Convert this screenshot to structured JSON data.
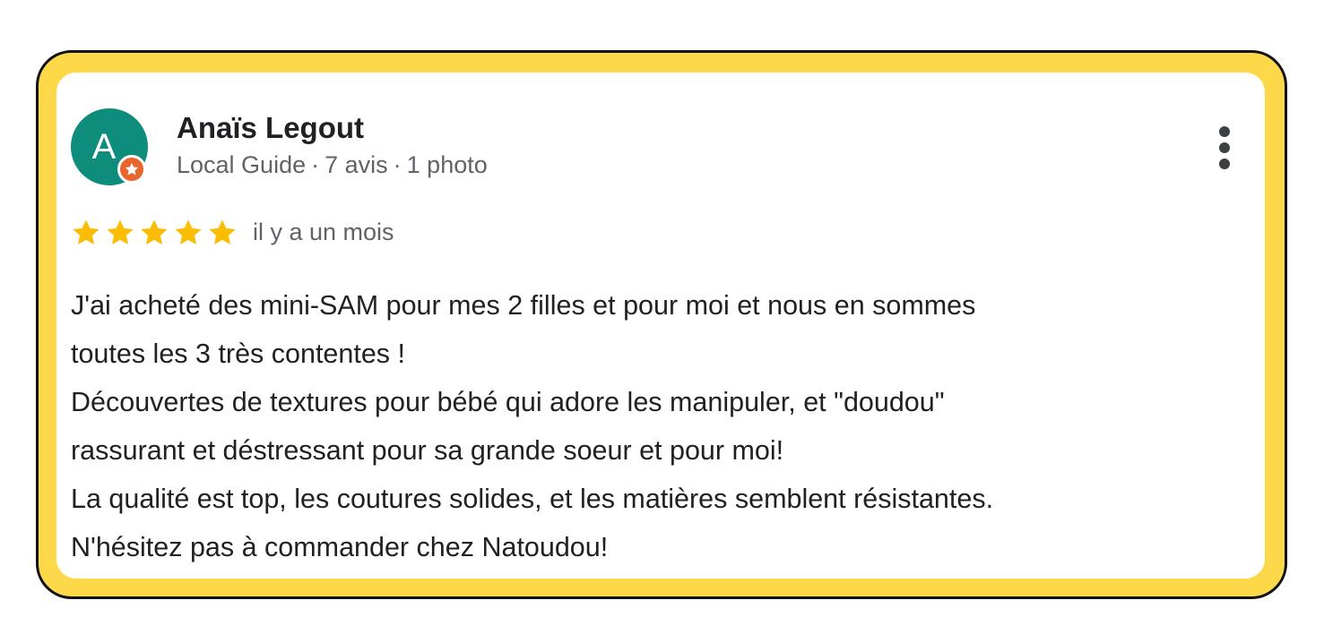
{
  "colors": {
    "frame": "#FDD94A",
    "avatar": "#0E8C7C",
    "badge": "#E8662B",
    "star": "#FBBC04",
    "text": "#202124",
    "muted": "#5f6368"
  },
  "review": {
    "author": {
      "avatar_letter": "A",
      "name": "Anaïs Legout",
      "badge_icon": "local-guide-star-icon",
      "level": "Local Guide",
      "reviews_count": "7 avis",
      "photos_count": "1 photo",
      "separator": "·"
    },
    "menu_icon": "more-vert-icon",
    "rating": 5,
    "rating_max": 5,
    "date": "il y a un mois",
    "text_lines": [
      "J'ai acheté des mini-SAM pour mes 2 filles et pour moi et nous en sommes",
      "toutes les 3 très contentes !",
      "Découvertes de textures pour bébé qui adore les manipuler, et \"doudou\"",
      "rassurant et déstressant pour sa grande soeur et pour moi!",
      "La qualité est top, les coutures solides, et les matières semblent résistantes.",
      "N'hésitez pas à commander chez Natoudou!"
    ]
  }
}
